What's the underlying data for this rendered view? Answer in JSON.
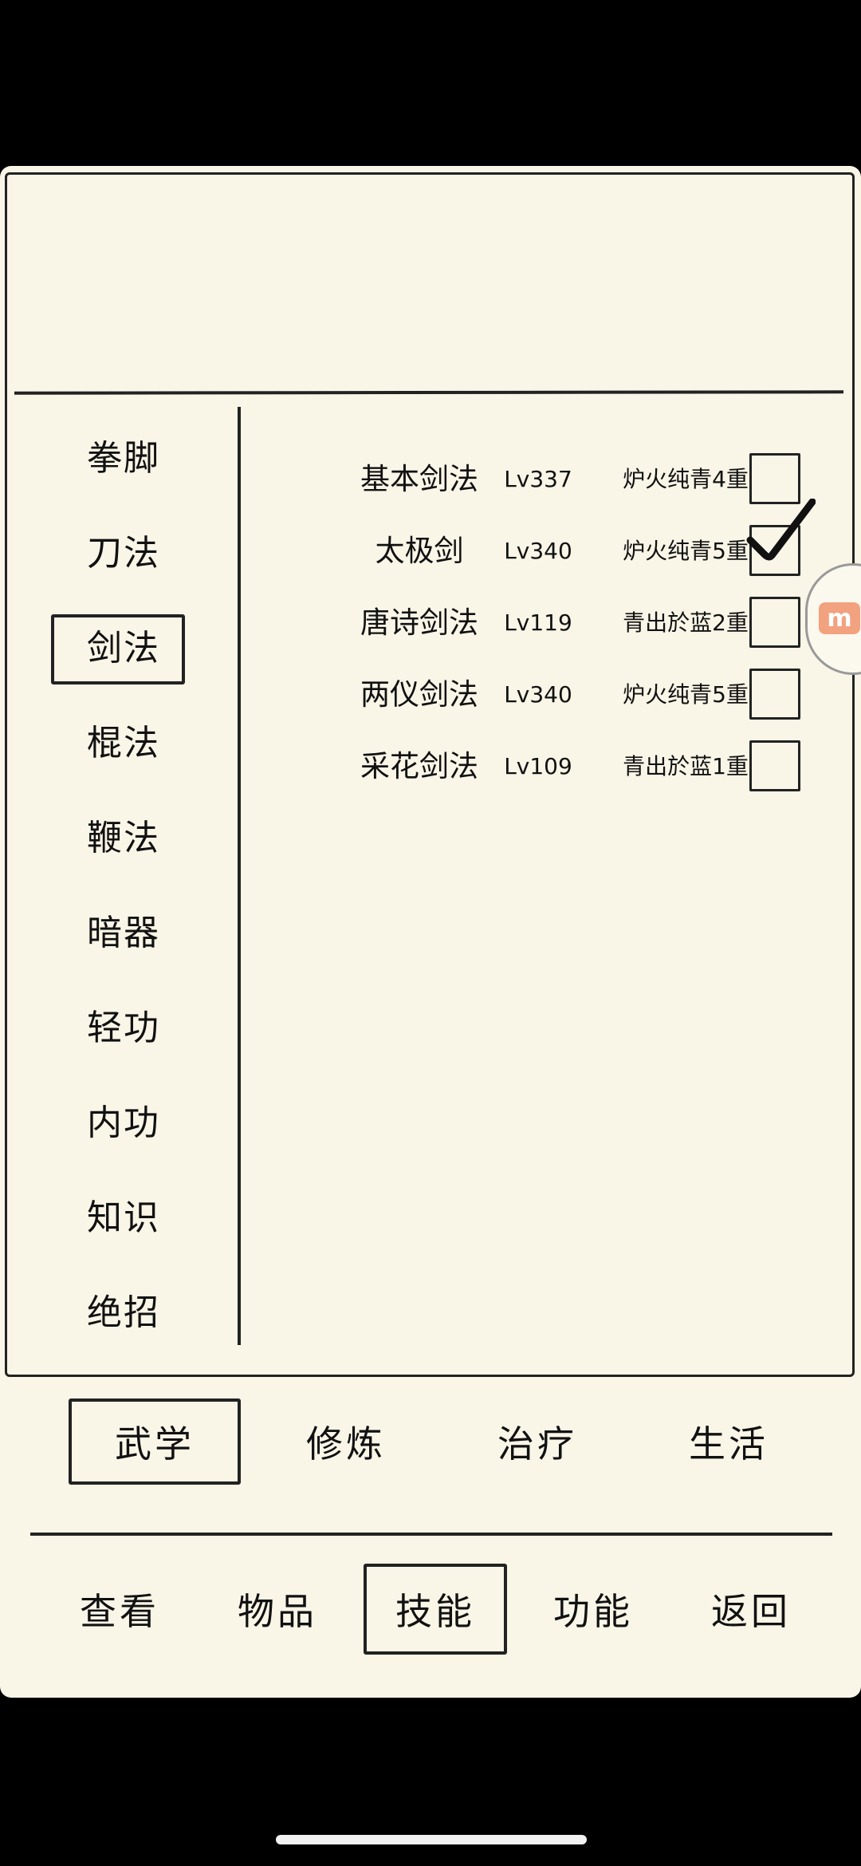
{
  "categories": [
    "拳脚",
    "刀法",
    "剑法",
    "棍法",
    "鞭法",
    "暗器",
    "轻功",
    "内功",
    "知识",
    "绝招"
  ],
  "selected_category": "剑法",
  "skills": [
    {
      "name": "基本剑法",
      "level": "Lv337",
      "stage": "炉火纯青4重",
      "checked": false
    },
    {
      "name": "太极剑",
      "level": "Lv340",
      "stage": "炉火纯青5重",
      "checked": true
    },
    {
      "name": "唐诗剑法",
      "level": "Lv119",
      "stage": "青出於蓝2重",
      "checked": false
    },
    {
      "name": "两仪剑法",
      "level": "Lv340",
      "stage": "炉火纯青5重",
      "checked": false
    },
    {
      "name": "采花剑法",
      "level": "Lv109",
      "stage": "青出於蓝1重",
      "checked": false
    }
  ],
  "subtabs": [
    "武学",
    "修炼",
    "治疗",
    "生活"
  ],
  "active_subtab": "武学",
  "nav": [
    "查看",
    "物品",
    "技能",
    "功能",
    "返回"
  ],
  "active_nav": "技能",
  "floating_button_icon": "app-logo-icon",
  "colors": {
    "paper": "#f9f5e7",
    "ink": "#222222",
    "float_accent": "#f2a27f"
  }
}
